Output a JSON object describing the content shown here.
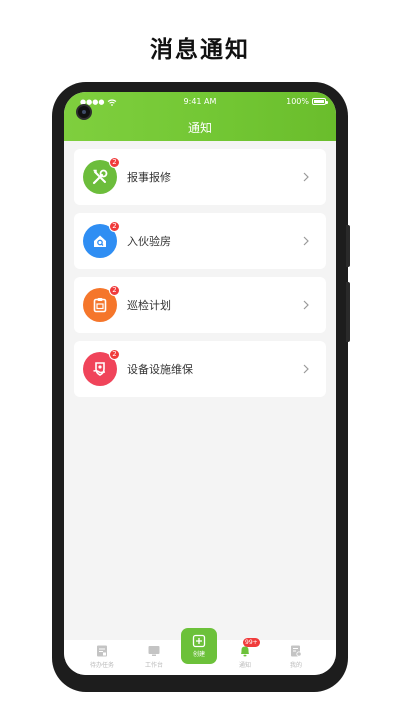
{
  "promo": {
    "title": "消息通知"
  },
  "status_bar": {
    "time": "9:41 AM",
    "battery": "100%",
    "signal_dots": "●●●●"
  },
  "header": {
    "title": "通知"
  },
  "colors": {
    "brand_green": "#74c83a",
    "badge_red": "#f03b3b"
  },
  "notifications": [
    {
      "label": "报事报修",
      "count": "2",
      "icon": "tools-icon",
      "color": "#6cbd3b"
    },
    {
      "label": "入伙验房",
      "count": "2",
      "icon": "house-icon",
      "color": "#2f8ef3"
    },
    {
      "label": "巡检计划",
      "count": "2",
      "icon": "clipboard-icon",
      "color": "#f5762b"
    },
    {
      "label": "设备设施维保",
      "count": "2",
      "icon": "shield-hand-icon",
      "color": "#f0445a"
    }
  ],
  "tabbar": {
    "todo": "待办任务",
    "workbench": "工作台",
    "create": "创建",
    "notice": "通知",
    "notice_badge": "99+",
    "mine": "我的"
  }
}
